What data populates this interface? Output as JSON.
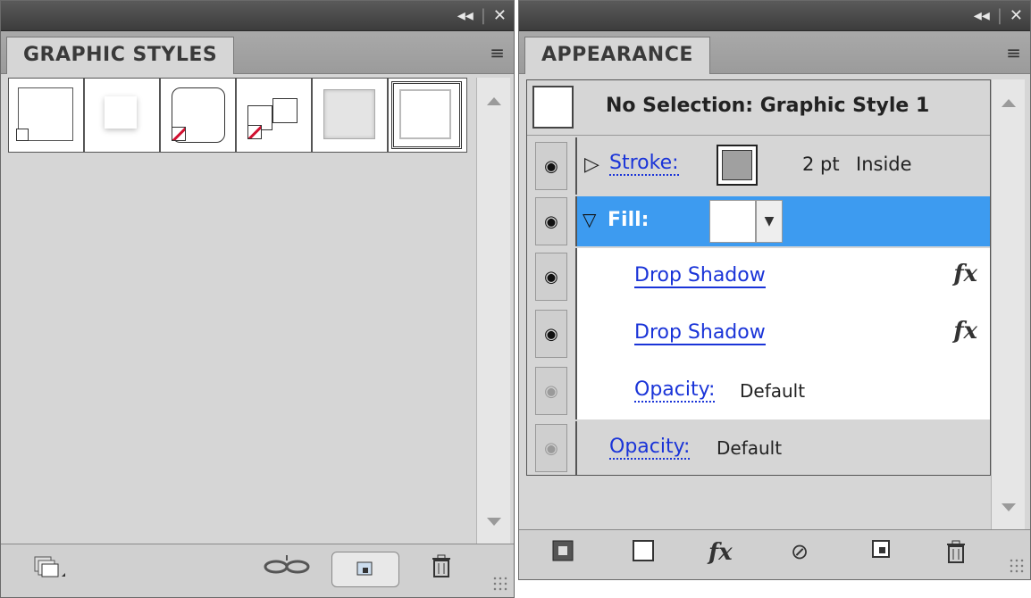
{
  "window_controls": {
    "collapse": "◂◂",
    "separator": "|",
    "close": "✕"
  },
  "graphic_styles": {
    "tab_label": "GRAPHIC STYLES",
    "menu_icon": "≡"
  },
  "appearance": {
    "tab_label": "APPEARANCE",
    "menu_icon": "≡",
    "header": "No Selection: Graphic Style 1",
    "stroke": {
      "label": "Stroke:",
      "weight": "2 pt",
      "align": "Inside"
    },
    "fill": {
      "label": "Fill:"
    },
    "effects": [
      {
        "label": "Drop Shadow",
        "fx": "fx"
      },
      {
        "label": "Drop Shadow",
        "fx": "fx"
      }
    ],
    "fill_opacity": {
      "label": "Opacity:",
      "value": "Default"
    },
    "opacity": {
      "label": "Opacity:",
      "value": "Default"
    },
    "bottom_fx": "fx"
  },
  "colors": {
    "selection": "#3d9bf0",
    "link": "#1a34d8"
  }
}
